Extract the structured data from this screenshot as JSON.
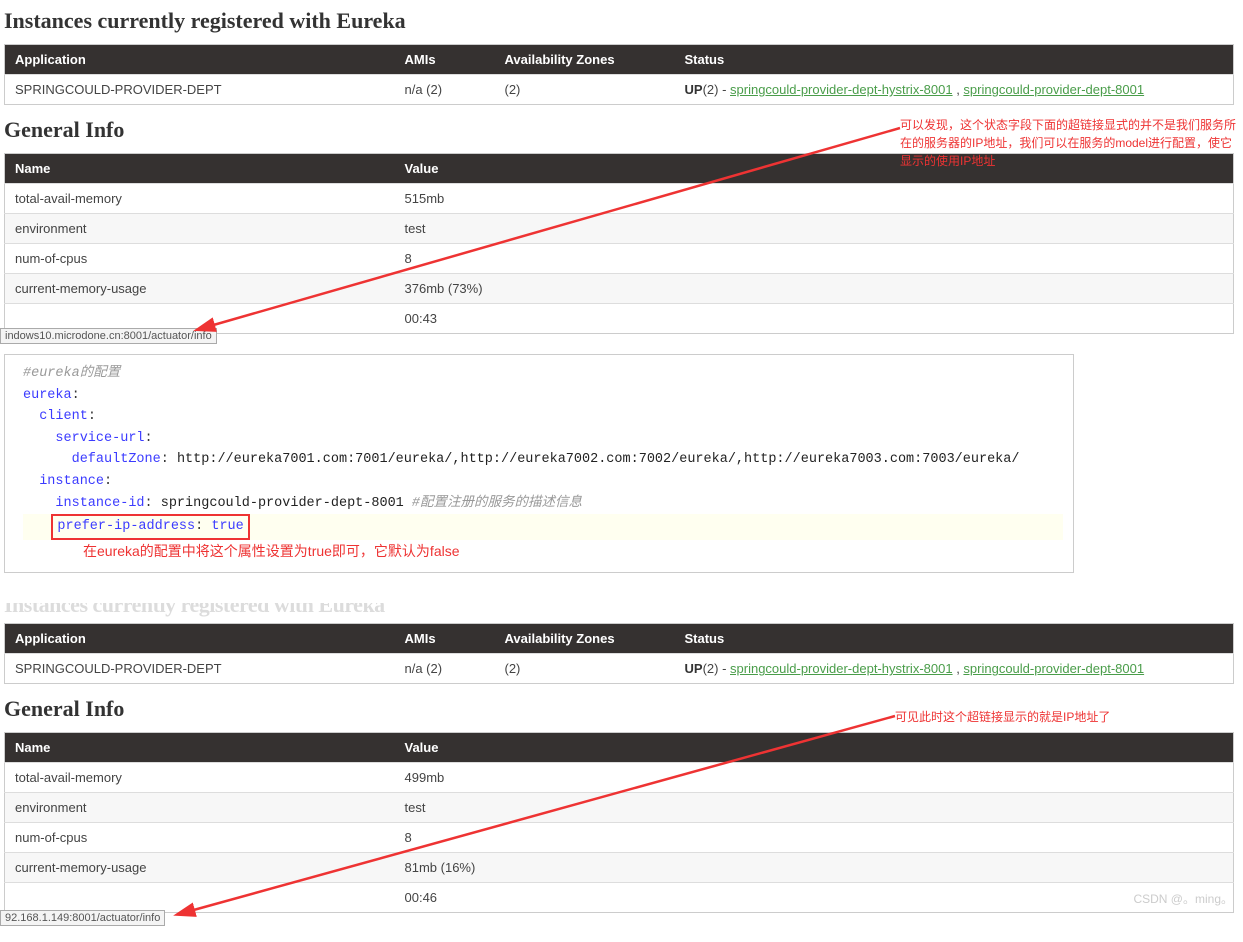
{
  "section1": {
    "heading": "Instances currently registered with Eureka",
    "instances_headers": [
      "Application",
      "AMIs",
      "Availability Zones",
      "Status"
    ],
    "instance_row": {
      "app": "SPRINGCOULD-PROVIDER-DEPT",
      "amis": "n/a (2)",
      "zones": "(2)",
      "up": "UP",
      "count": "(2)",
      "sep": " - ",
      "link1": "springcould-provider-dept-hystrix-8001",
      "comma": " , ",
      "link2": "springcould-provider-dept-8001"
    },
    "general_heading": "General Info",
    "general_headers": [
      "Name",
      "Value"
    ],
    "general_rows": [
      {
        "name": "total-avail-memory",
        "value": "515mb"
      },
      {
        "name": "environment",
        "value": "test"
      },
      {
        "name": "num-of-cpus",
        "value": "8"
      },
      {
        "name": "current-memory-usage",
        "value": "376mb (73%)"
      },
      {
        "name": "",
        "value": "00:43"
      }
    ],
    "tooltip": "indows10.microdone.cn:8001/actuator/info",
    "annotation": "可以发现，这个状态字段下面的超链接显式的并不是我们服务所在的服务器的IP地址，我们可以在服务的model进行配置，使它显示的使用IP地址"
  },
  "code": {
    "c1": "#eureka的配置",
    "l1_k": "eureka",
    "l2_k": "client",
    "l3_k": "service-url",
    "l4_k": "defaultZone",
    "l4_v": "http://eureka7001.com:7001/eureka/,http://eureka7002.com:7002/eureka/,http://eureka7003.com:7003/eureka/",
    "l5_k": "instance",
    "l6_k": "instance-id",
    "l6_v": "springcould-provider-dept-8001 ",
    "l6_c": "#配置注册的服务的描述信息",
    "l7_k": "prefer-ip-address",
    "l7_v": "true",
    "note": "在eureka的配置中将这个属性设置为true即可，它默认为false"
  },
  "section2": {
    "cut_heading": "Instances currently registered with Eureka",
    "instances_headers": [
      "Application",
      "AMIs",
      "Availability Zones",
      "Status"
    ],
    "instance_row": {
      "app": "SPRINGCOULD-PROVIDER-DEPT",
      "amis": "n/a (2)",
      "zones": "(2)",
      "up": "UP",
      "count": "(2)",
      "sep": " - ",
      "link1": "springcould-provider-dept-hystrix-8001",
      "comma": " , ",
      "link2": "springcould-provider-dept-8001"
    },
    "general_heading": "General Info",
    "general_headers": [
      "Name",
      "Value"
    ],
    "general_rows": [
      {
        "name": "total-avail-memory",
        "value": "499mb"
      },
      {
        "name": "environment",
        "value": "test"
      },
      {
        "name": "num-of-cpus",
        "value": "8"
      },
      {
        "name": "current-memory-usage",
        "value": "81mb (16%)"
      },
      {
        "name": "",
        "value": "00:46"
      }
    ],
    "tooltip": "92.168.1.149:8001/actuator/info",
    "annotation": "可见此时这个超链接显示的就是IP地址了"
  },
  "watermark": "CSDN @。ming。"
}
